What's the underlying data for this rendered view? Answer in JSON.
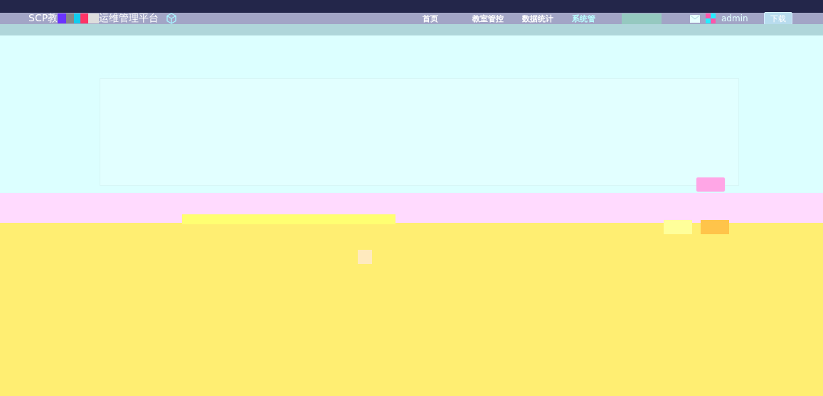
{
  "header": {
    "title_start": "SCP教",
    "title_end": "运维管理平台"
  },
  "nav": [
    {
      "label": "首页",
      "selected": false
    },
    {
      "label": "教室管控",
      "selected": false
    },
    {
      "label": "数据统计",
      "selected": false
    },
    {
      "label": "系统管",
      "selected": true
    }
  ],
  "user": {
    "name": "admin",
    "download_button": "下载"
  }
}
